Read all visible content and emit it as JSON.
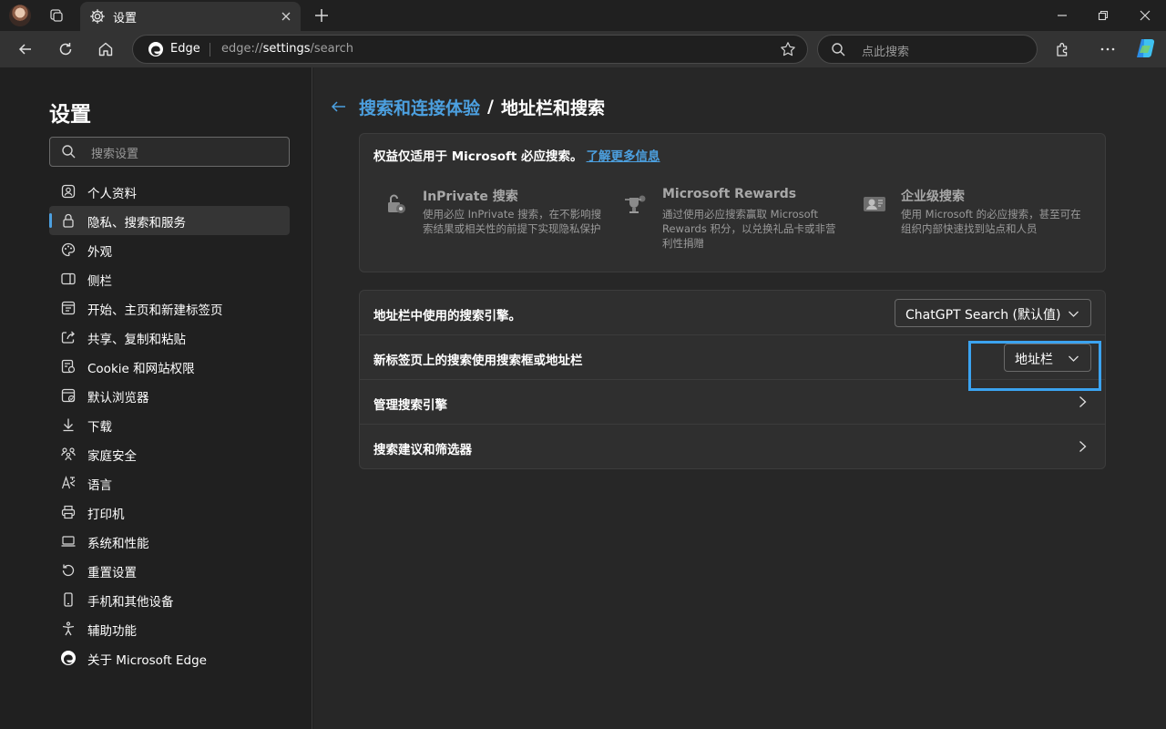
{
  "window": {
    "tab_title": "设置"
  },
  "toolbar": {
    "site_name": "Edge",
    "url_prefix": "edge://",
    "url_highlight": "settings",
    "url_suffix": "/search",
    "search_placeholder": "点此搜索"
  },
  "sidebar": {
    "title": "设置",
    "search_placeholder": "搜索设置",
    "items": [
      {
        "label": "个人资料",
        "icon": "profile-icon"
      },
      {
        "label": "隐私、搜索和服务",
        "icon": "lock-icon",
        "active": true
      },
      {
        "label": "外观",
        "icon": "palette-icon"
      },
      {
        "label": "侧栏",
        "icon": "sidebar-icon"
      },
      {
        "label": "开始、主页和新建标签页",
        "icon": "home-tab-icon"
      },
      {
        "label": "共享、复制和粘贴",
        "icon": "share-icon"
      },
      {
        "label": "Cookie 和网站权限",
        "icon": "cookie-icon"
      },
      {
        "label": "默认浏览器",
        "icon": "browser-icon"
      },
      {
        "label": "下载",
        "icon": "download-icon"
      },
      {
        "label": "家庭安全",
        "icon": "family-icon"
      },
      {
        "label": "语言",
        "icon": "language-icon"
      },
      {
        "label": "打印机",
        "icon": "printer-icon"
      },
      {
        "label": "系统和性能",
        "icon": "laptop-icon"
      },
      {
        "label": "重置设置",
        "icon": "reset-icon"
      },
      {
        "label": "手机和其他设备",
        "icon": "phone-icon"
      },
      {
        "label": "辅助功能",
        "icon": "accessibility-icon"
      },
      {
        "label": "关于 Microsoft Edge",
        "icon": "edge-icon"
      }
    ]
  },
  "main": {
    "breadcrumb_parent": "搜索和连接体验",
    "breadcrumb_sep": "/",
    "breadcrumb_current": "地址栏和搜索",
    "benefits": {
      "heading": "权益仅适用于 Microsoft 必应搜索。",
      "link": "了解更多信息",
      "features": [
        {
          "title": "InPrivate 搜索",
          "desc": "使用必应 InPrivate 搜索，在不影响搜索结果或相关性的前提下实现隐私保护"
        },
        {
          "title": "Microsoft Rewards",
          "desc": "通过使用必应搜索赢取 Microsoft Rewards 积分，以兑换礼品卡或非营利性捐赠"
        },
        {
          "title": "企业级搜索",
          "desc": "使用 Microsoft 的必应搜索，甚至可在组织内部快速找到站点和人员"
        }
      ]
    },
    "settings": [
      {
        "label": "地址栏中使用的搜索引擎。",
        "value": "ChatGPT Search (默认值)"
      },
      {
        "label": "新标签页上的搜索使用搜索框或地址栏",
        "value": "地址栏"
      },
      {
        "label": "管理搜索引擎"
      },
      {
        "label": "搜索建议和筛选器"
      }
    ]
  },
  "colors": {
    "accent": "#4ca0e0",
    "highlight_box": "#3ba3f0"
  }
}
